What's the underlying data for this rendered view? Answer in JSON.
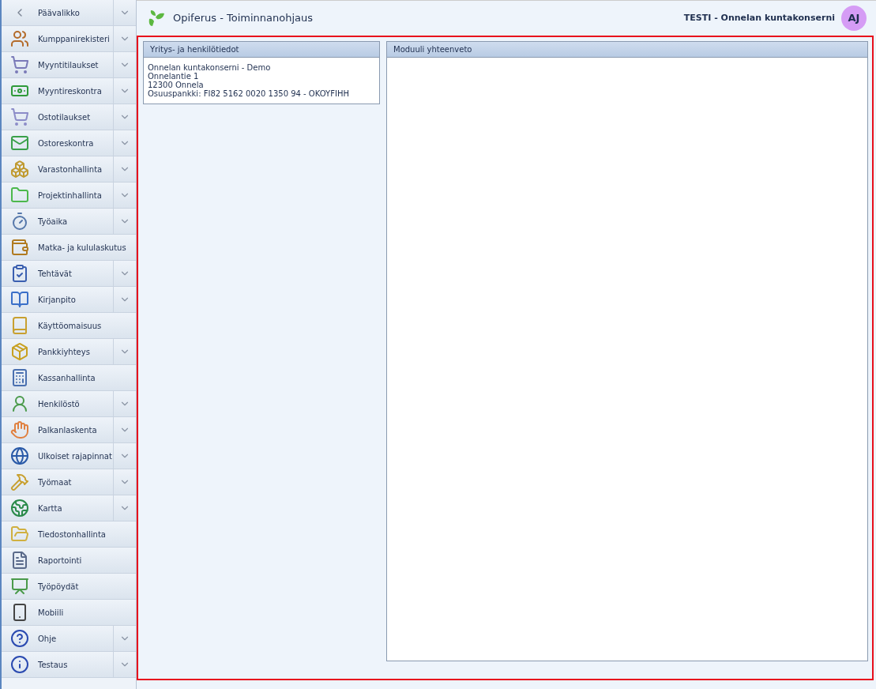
{
  "sidebar": {
    "back": {
      "label": "Päävalikko",
      "expandable": true
    },
    "items": [
      {
        "label": "Kumppanirekisteri",
        "expandable": true
      },
      {
        "label": "Myyntitilaukset",
        "expandable": true
      },
      {
        "label": "Myyntireskontra",
        "expandable": true
      },
      {
        "label": "Ostotilaukset",
        "expandable": true
      },
      {
        "label": "Ostoreskontra",
        "expandable": true
      },
      {
        "label": "Varastonhallinta",
        "expandable": true
      },
      {
        "label": "Projektinhallinta",
        "expandable": true
      },
      {
        "label": "Työaika",
        "expandable": true
      },
      {
        "label": "Matka- ja kululaskutus",
        "expandable": false
      },
      {
        "label": "Tehtävät",
        "expandable": true
      },
      {
        "label": "Kirjanpito",
        "expandable": true
      },
      {
        "label": "Käyttöomaisuus",
        "expandable": false
      },
      {
        "label": "Pankkiyhteys",
        "expandable": true
      },
      {
        "label": "Kassanhallinta",
        "expandable": false
      },
      {
        "label": "Henkilöstö",
        "expandable": true
      },
      {
        "label": "Palkanlaskenta",
        "expandable": true
      },
      {
        "label": "Ulkoiset rajapinnat",
        "expandable": true
      },
      {
        "label": "Työmaat",
        "expandable": true
      },
      {
        "label": "Kartta",
        "expandable": true
      },
      {
        "label": "Tiedostonhallinta",
        "expandable": false
      },
      {
        "label": "Raportointi",
        "expandable": false
      },
      {
        "label": "Työpöydät",
        "expandable": false
      },
      {
        "label": "Mobiili",
        "expandable": false
      },
      {
        "label": "Ohje",
        "expandable": true
      },
      {
        "label": "Testaus",
        "expandable": true
      }
    ]
  },
  "header": {
    "title": "Opiferus - Toiminnanohjaus",
    "user": "TESTI - Onnelan kuntakonserni",
    "avatar": "AJ"
  },
  "panels": [
    {
      "title": "Yritys- ja henkilötiedot",
      "lines": [
        "Onnelan kuntakonserni - Demo",
        "Onnelantie 1",
        "12300 Onnela",
        "Osuuspankki: FI82 5162 0020 1350 94 - OKOYFIHH"
      ]
    },
    {
      "title": "Moduuli yhteenveto"
    }
  ]
}
